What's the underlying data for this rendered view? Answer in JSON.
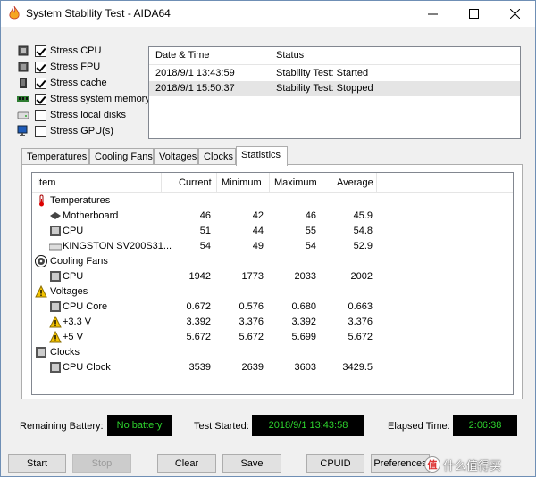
{
  "window": {
    "title": "System Stability Test - AIDA64"
  },
  "stress": [
    {
      "label": "Stress CPU",
      "checked": true,
      "icon": "cpu-chip-icon"
    },
    {
      "label": "Stress FPU",
      "checked": true,
      "icon": "fpu-chip-icon"
    },
    {
      "label": "Stress cache",
      "checked": true,
      "icon": "cache-chip-icon"
    },
    {
      "label": "Stress system memory",
      "checked": true,
      "icon": "memory-module-icon"
    },
    {
      "label": "Stress local disks",
      "checked": false,
      "icon": "disk-drive-icon"
    },
    {
      "label": "Stress GPU(s)",
      "checked": false,
      "icon": "gpu-monitor-icon"
    }
  ],
  "log": {
    "headers": {
      "datetime": "Date & Time",
      "status": "Status"
    },
    "rows": [
      {
        "datetime": "2018/9/1 13:43:59",
        "status": "Stability Test: Started"
      },
      {
        "datetime": "2018/9/1 15:50:37",
        "status": "Stability Test: Stopped"
      }
    ]
  },
  "tabs": [
    "Temperatures",
    "Cooling Fans",
    "Voltages",
    "Clocks",
    "Statistics"
  ],
  "stats": {
    "headers": {
      "item": "Item",
      "current": "Current",
      "minimum": "Minimum",
      "maximum": "Maximum",
      "average": "Average"
    },
    "groups": {
      "temperatures": "Temperatures",
      "fans": "Cooling Fans",
      "voltages": "Voltages",
      "clocks": "Clocks"
    },
    "rows": {
      "motherboard": {
        "label": "Motherboard",
        "current": "46",
        "minimum": "42",
        "maximum": "46",
        "average": "45.9"
      },
      "cpu_temp": {
        "label": "CPU",
        "current": "51",
        "minimum": "44",
        "maximum": "55",
        "average": "54.8"
      },
      "ssd": {
        "label": "KINGSTON SV200S31...",
        "current": "54",
        "minimum": "49",
        "maximum": "54",
        "average": "52.9"
      },
      "cpu_fan": {
        "label": "CPU",
        "current": "1942",
        "minimum": "1773",
        "maximum": "2033",
        "average": "2002"
      },
      "cpu_core": {
        "label": "CPU Core",
        "current": "0.672",
        "minimum": "0.576",
        "maximum": "0.680",
        "average": "0.663"
      },
      "v33": {
        "label": "+3.3 V",
        "current": "3.392",
        "minimum": "3.376",
        "maximum": "3.392",
        "average": "3.376"
      },
      "v5": {
        "label": "+5 V",
        "current": "5.672",
        "minimum": "5.672",
        "maximum": "5.699",
        "average": "5.672"
      },
      "cpu_clock": {
        "label": "CPU Clock",
        "current": "3539",
        "minimum": "2639",
        "maximum": "3603",
        "average": "3429.5"
      }
    }
  },
  "status": {
    "battery_label": "Remaining Battery:",
    "battery_value": "No battery",
    "started_label": "Test Started:",
    "started_value": "2018/9/1 13:43:58",
    "elapsed_label": "Elapsed Time:",
    "elapsed_value": "2:06:38"
  },
  "buttons": {
    "start": "Start",
    "stop": "Stop",
    "clear": "Clear",
    "save": "Save",
    "cpuid": "CPUID",
    "preferences": "Preferences"
  },
  "watermark": {
    "badge": "值",
    "text": "什么值得买"
  },
  "colors": {
    "lcd_text": "#2dd12d",
    "selected_row": "#e5e5e5"
  }
}
